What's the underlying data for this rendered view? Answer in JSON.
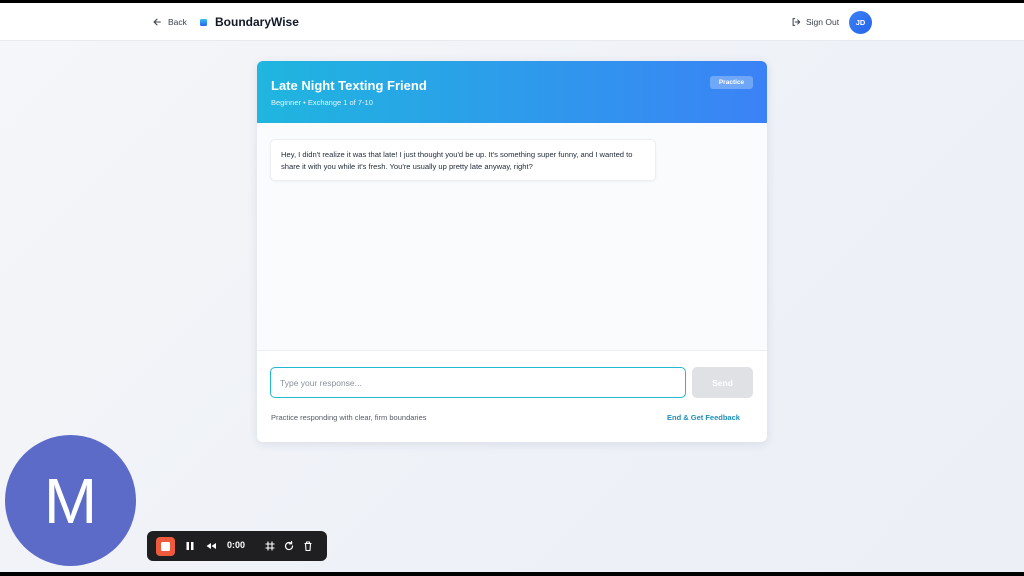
{
  "nav": {
    "back_label": "Back",
    "brand": "BoundaryWise",
    "signout_label": "Sign Out",
    "avatar_initials": "JD"
  },
  "scenario": {
    "title": "Late Night Texting Friend",
    "subtitle": "Beginner • Exchange 1 of 7-10",
    "badge": "Practice"
  },
  "messages": [
    {
      "sender": "friend",
      "text": "Hey, I didn't realize it was that late! I just thought you'd be up. It's something super funny, and I wanted to share it with you while it's fresh. You're usually up pretty late anyway, right?"
    }
  ],
  "composer": {
    "placeholder": "Type your response...",
    "value": "",
    "send_label": "Send",
    "hint": "Practice responding with clear, firm boundaries",
    "end_label": "End & Get Feedback"
  },
  "overlay": {
    "avatar_letter": "M"
  },
  "recorder": {
    "time": "0:00"
  },
  "colors": {
    "header_gradient_start": "#1fb6df",
    "header_gradient_end": "#3b82f6",
    "input_focus_border": "#22b8cf",
    "link": "#1d8fb8",
    "record_stop": "#ef5a3c",
    "overlay_avatar": "#5b6bc7"
  },
  "icons": {
    "back": "arrow-left-icon",
    "brand": "square-logo-icon",
    "signout": "log-out-icon",
    "rec_stop": "stop-icon",
    "rec_pause": "pause-icon",
    "rec_rewind": "rewind-icon",
    "rec_grid": "grid-icon",
    "rec_restart": "restart-icon",
    "rec_delete": "trash-icon"
  }
}
